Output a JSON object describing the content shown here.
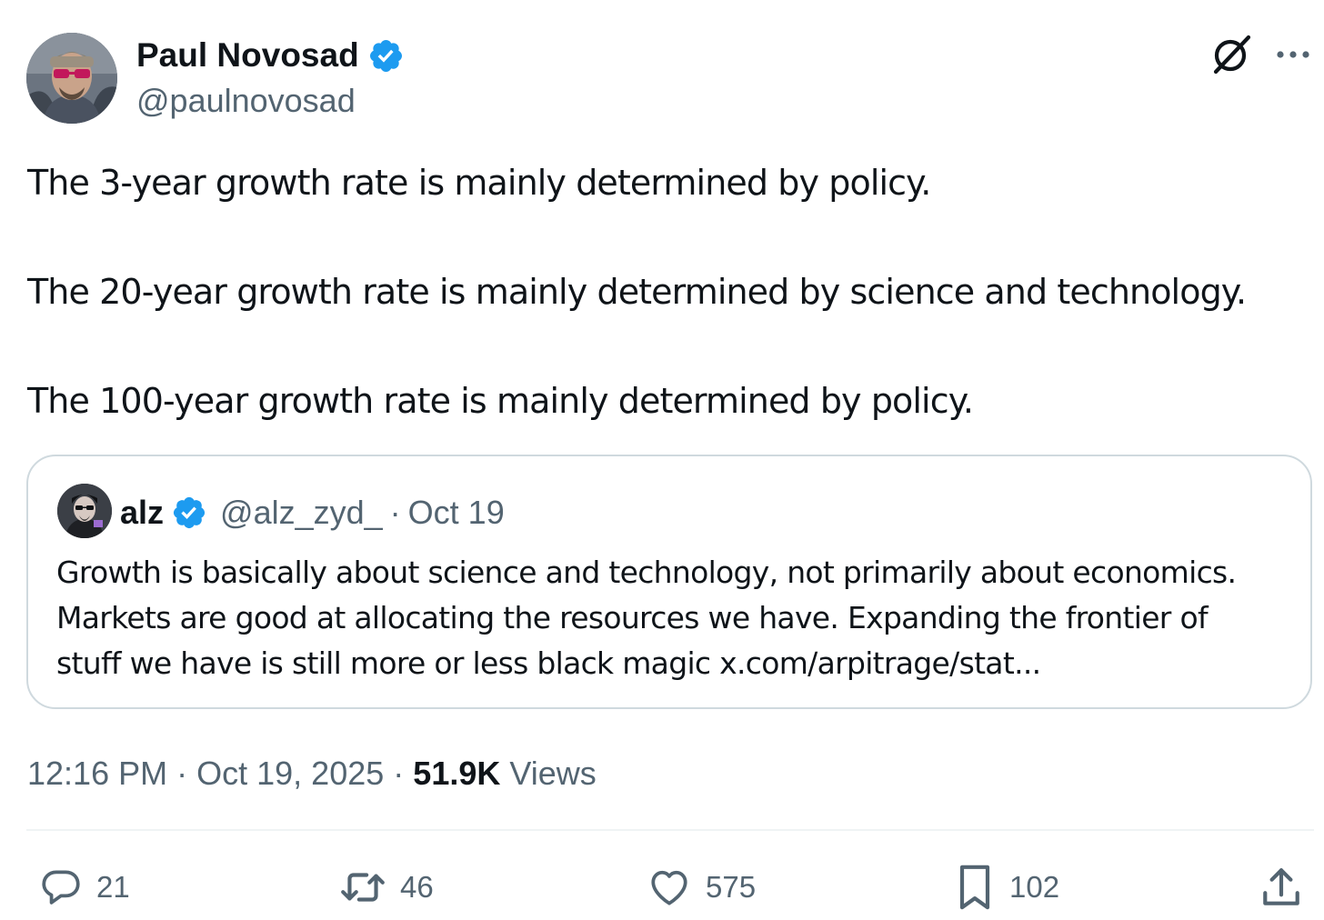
{
  "author": {
    "name": "Paul Novosad",
    "handle": "@paulnovosad",
    "verified": true
  },
  "tweet": {
    "lines": [
      "The 3-year growth rate is mainly determined by policy.",
      "The 20-year growth rate is mainly determined by science and technology.",
      "The 100-year growth rate is mainly determined by policy."
    ]
  },
  "quote": {
    "name": "alz",
    "handle": "@alz_zyd_",
    "separator": "·",
    "date": "Oct 19",
    "verified": true,
    "text_lines": [
      "Growth is basically about science and technology, not primarily about economics.",
      "Markets are good at allocating the resources we have. Expanding the frontier of",
      "stuff we have is still more or less black magic x.com/arpitrage/stat..."
    ]
  },
  "meta": {
    "time": "12:16 PM",
    "separator": "·",
    "date": "Oct 19, 2025",
    "views_count": "51.9K",
    "views_label": "Views"
  },
  "actions": {
    "replies": "21",
    "reposts": "46",
    "likes": "575",
    "bookmarks": "102"
  },
  "icons": {
    "verified": "verified-badge-icon",
    "grok": "grok-icon",
    "more": "more-icon",
    "reply": "reply-icon",
    "repost": "repost-icon",
    "like": "like-icon",
    "bookmark": "bookmark-icon",
    "share": "share-icon"
  },
  "colors": {
    "text_primary": "#0f1419",
    "text_secondary": "#536471",
    "verified_blue": "#1d9bf0",
    "border": "#cfd9de",
    "divider": "#eff3f4"
  }
}
